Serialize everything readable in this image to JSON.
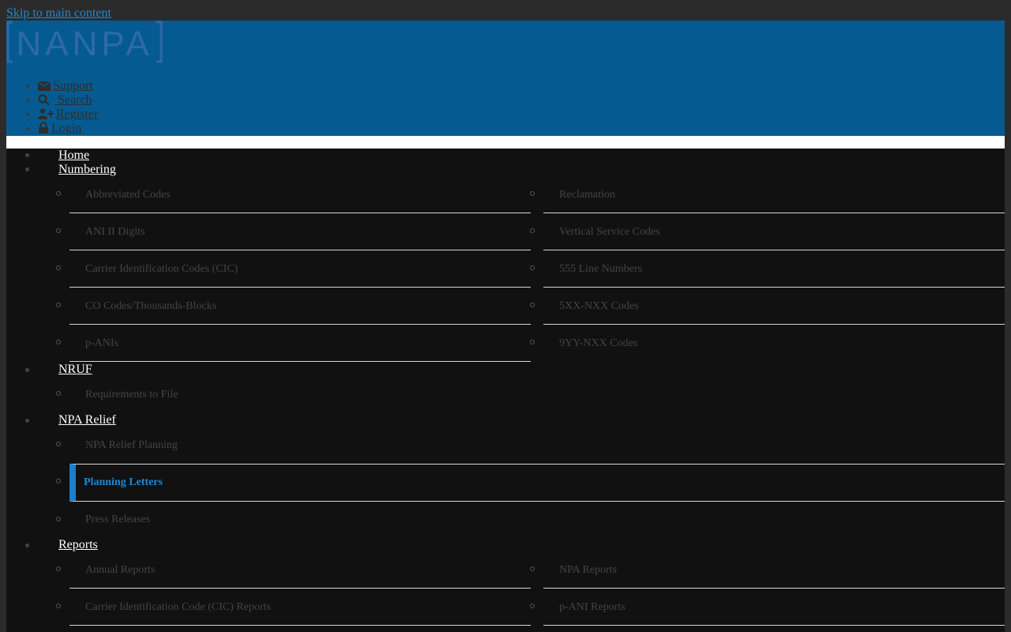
{
  "skip_link": "Skip to main content",
  "brand": {
    "logo_text": "NANPA",
    "header_color": "#055b91"
  },
  "utility_nav": [
    {
      "label": "Support",
      "icon": "envelope-icon"
    },
    {
      "label": "Search",
      "icon": "search-icon"
    },
    {
      "label": "Register",
      "icon": "user-plus-icon"
    },
    {
      "label": "Login",
      "icon": "lock-icon"
    }
  ],
  "main_nav": {
    "home": "Home",
    "numbering": {
      "label": "Numbering",
      "left": [
        "Abbreviated Codes",
        "ANI II Digits",
        "Carrier Identification Codes (CIC)",
        "CO Codes/Thousands-Blocks",
        "p-ANIs"
      ],
      "right": [
        "Reclamation",
        "Vertical Service Codes",
        "555 Line Numbers",
        "5XX-NXX Codes",
        "9YY-NXX Codes"
      ]
    },
    "nruf": {
      "label": "NRUF",
      "items": [
        "Requirements to File"
      ]
    },
    "npa_relief": {
      "label": "NPA Relief",
      "items": [
        "NPA Relief Planning",
        "Planning Letters",
        "Press Releases"
      ],
      "active": "Planning Letters"
    },
    "reports": {
      "label": "Reports",
      "left": [
        "Annual Reports",
        "Carrier Identification Code (CIC) Reports"
      ],
      "right": [
        "NPA Reports",
        "p-ANI Reports"
      ]
    }
  },
  "colors": {
    "active_accent": "#1a7fcc",
    "link": "#1e88d6",
    "nav_bg": "#111111"
  }
}
